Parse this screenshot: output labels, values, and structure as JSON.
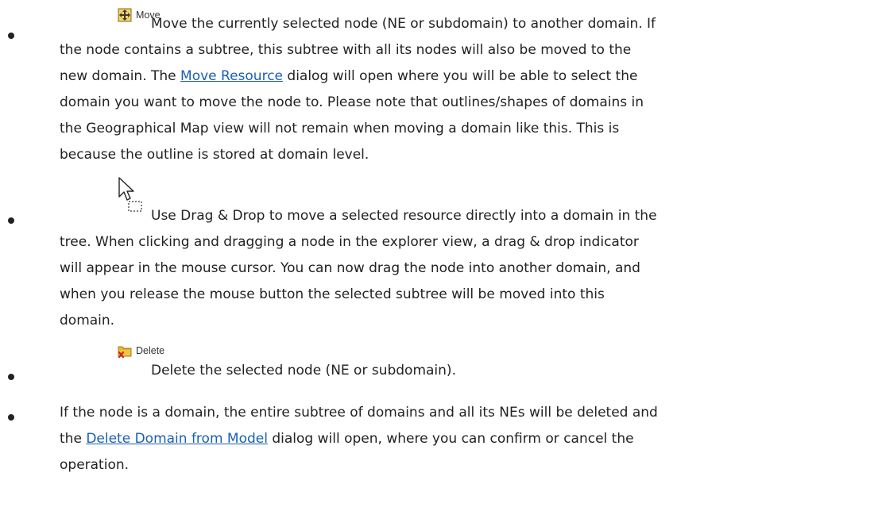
{
  "items": [
    {
      "icon_label": "Move",
      "icon": "move-icon",
      "lines": [
        [
          {
            "t": "Move the currently selected node (NE or subdomain) to another domain. If"
          }
        ],
        [
          {
            "t": "the node contains a subtree, this subtree with all its nodes will also be moved to the"
          }
        ],
        [
          {
            "t": "new domain. The "
          },
          {
            "t": "Move Resource",
            "link": true
          },
          {
            "t": " dialog will open where you will be able to select the"
          }
        ],
        [
          {
            "t": "domain you want to move the node to. Please note that outlines/shapes of domains in"
          }
        ],
        [
          {
            "t": "the Geographical Map view will not remain when moving a domain like this. This is"
          }
        ],
        [
          {
            "t": "because the outline is stored at domain level."
          }
        ]
      ]
    },
    {
      "icon": "drag-drop-cursor-icon",
      "lines": [
        [
          {
            "t": "Use Drag & Drop to move a selected resource directly into a domain in the"
          }
        ],
        [
          {
            "t": "tree. When clicking and dragging a node in the explorer view, a drag & drop indicator"
          }
        ],
        [
          {
            "t": "will appear in the mouse cursor. You can now drag the node into another domain, and"
          }
        ],
        [
          {
            "t": "when you release the mouse button the selected subtree will be moved into this"
          }
        ],
        [
          {
            "t": "domain."
          }
        ]
      ]
    },
    {
      "icon_label": "Delete",
      "icon": "delete-folder-icon",
      "lines": [
        [
          {
            "t": "Delete the selected node (NE or subdomain)."
          }
        ]
      ]
    },
    {
      "lines": [
        [
          {
            "t": "If the node is a domain, the entire subtree of domains and all its NEs will be deleted and"
          }
        ],
        [
          {
            "t": "the "
          },
          {
            "t": "Delete Domain from Model",
            "link": true
          },
          {
            "t": " dialog will open, where you can confirm or cancel the"
          }
        ],
        [
          {
            "t": "operation."
          }
        ]
      ]
    }
  ],
  "colors": {
    "text": "#222222",
    "link": "#1a5fb4",
    "move_icon": "#c8a028",
    "delete_icon": "#e0b030",
    "delete_x": "#cc2a1a"
  }
}
